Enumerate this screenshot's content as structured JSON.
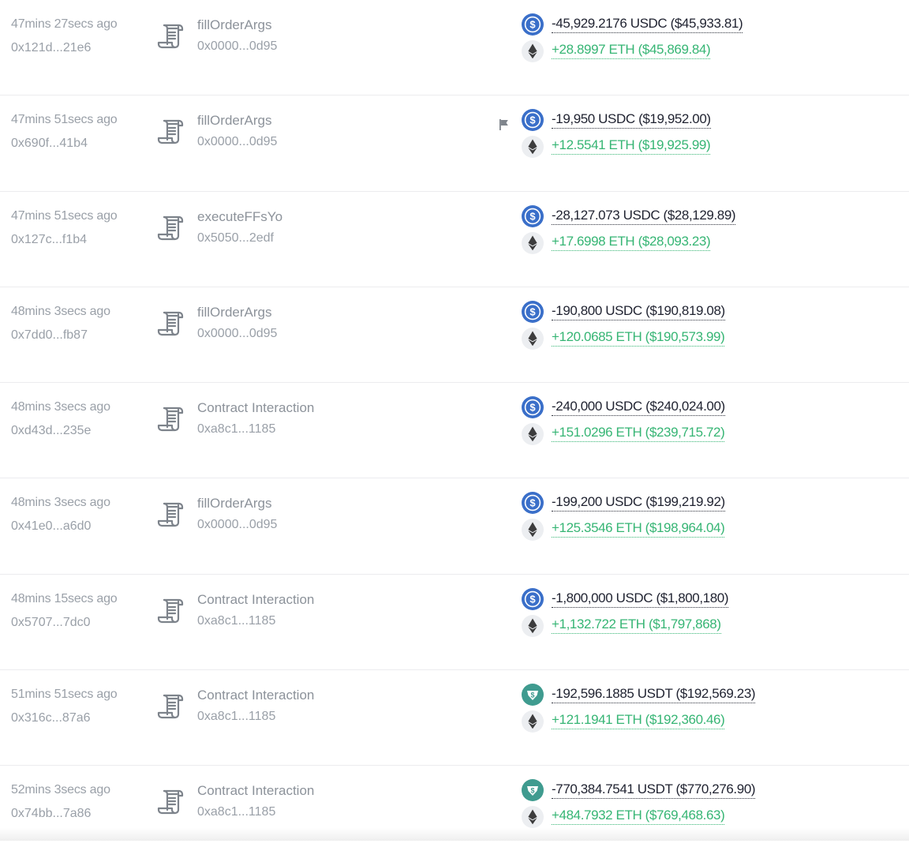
{
  "transactions": [
    {
      "time": "47mins 27secs ago",
      "hash": "0x121d...21e6",
      "method": "fillOrderArgs",
      "to": "0x0000...0d95",
      "flagged": false,
      "out_token": "usdc",
      "out_amount": "-45,929.2176 USDC ($45,933.81)",
      "in_token": "eth",
      "in_amount": "+28.8997 ETH ($45,869.84)"
    },
    {
      "time": "47mins 51secs ago",
      "hash": "0x690f...41b4",
      "method": "fillOrderArgs",
      "to": "0x0000...0d95",
      "flagged": true,
      "out_token": "usdc",
      "out_amount": "-19,950 USDC ($19,952.00)",
      "in_token": "eth",
      "in_amount": "+12.5541 ETH ($19,925.99)"
    },
    {
      "time": "47mins 51secs ago",
      "hash": "0x127c...f1b4",
      "method": "executeFFsYo",
      "to": "0x5050...2edf",
      "flagged": false,
      "out_token": "usdc",
      "out_amount": "-28,127.073 USDC ($28,129.89)",
      "in_token": "eth",
      "in_amount": "+17.6998 ETH ($28,093.23)"
    },
    {
      "time": "48mins 3secs ago",
      "hash": "0x7dd0...fb87",
      "method": "fillOrderArgs",
      "to": "0x0000...0d95",
      "flagged": false,
      "out_token": "usdc",
      "out_amount": "-190,800 USDC ($190,819.08)",
      "in_token": "eth",
      "in_amount": "+120.0685 ETH ($190,573.99)"
    },
    {
      "time": "48mins 3secs ago",
      "hash": "0xd43d...235e",
      "method": "Contract Interaction",
      "to": "0xa8c1...1185",
      "flagged": false,
      "out_token": "usdc",
      "out_amount": "-240,000 USDC ($240,024.00)",
      "in_token": "eth",
      "in_amount": "+151.0296 ETH ($239,715.72)"
    },
    {
      "time": "48mins 3secs ago",
      "hash": "0x41e0...a6d0",
      "method": "fillOrderArgs",
      "to": "0x0000...0d95",
      "flagged": false,
      "out_token": "usdc",
      "out_amount": "-199,200 USDC ($199,219.92)",
      "in_token": "eth",
      "in_amount": "+125.3546 ETH ($198,964.04)"
    },
    {
      "time": "48mins 15secs ago",
      "hash": "0x5707...7dc0",
      "method": "Contract Interaction",
      "to": "0xa8c1...1185",
      "flagged": false,
      "out_token": "usdc",
      "out_amount": "-1,800,000 USDC ($1,800,180)",
      "in_token": "eth",
      "in_amount": "+1,132.722 ETH ($1,797,868)"
    },
    {
      "time": "51mins 51secs ago",
      "hash": "0x316c...87a6",
      "method": "Contract Interaction",
      "to": "0xa8c1...1185",
      "flagged": false,
      "out_token": "usdt",
      "out_amount": "-192,596.1885 USDT ($192,569.23)",
      "in_token": "eth",
      "in_amount": "+121.1941 ETH ($192,360.46)"
    },
    {
      "time": "52mins 3secs ago",
      "hash": "0x74bb...7a86",
      "method": "Contract Interaction",
      "to": "0xa8c1...1185",
      "flagged": false,
      "out_token": "usdt",
      "out_amount": "-770,384.7541 USDT ($770,276.90)",
      "in_token": "eth",
      "in_amount": "+484.7932 ETH ($769,468.63)"
    }
  ],
  "icons": {
    "method": "scroll-icon",
    "flag": "flag-icon",
    "usdc": "usdc-icon",
    "usdt": "usdt-icon",
    "eth": "eth-icon"
  },
  "colors": {
    "usdc": "#3a6fc9",
    "usdt": "#3f9b8f",
    "eth_bg": "#eceef1",
    "eth": "#3c3c3d",
    "negative": "#1f2230",
    "positive": "#36b574",
    "muted": "#9aa0a8"
  }
}
